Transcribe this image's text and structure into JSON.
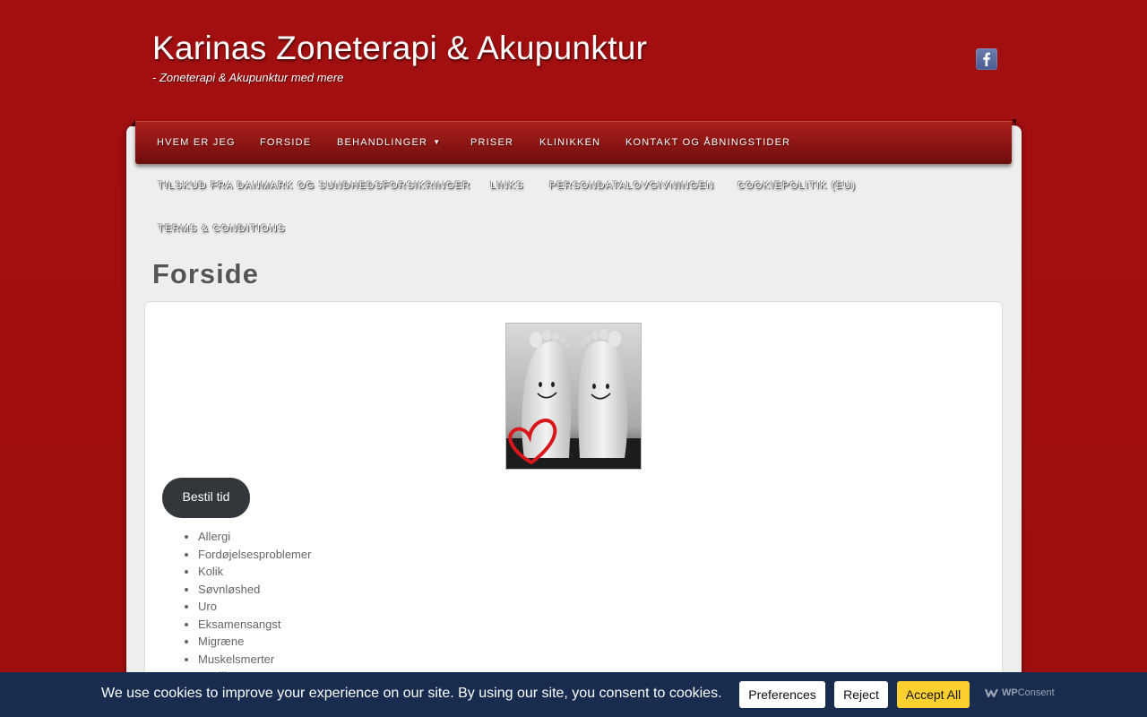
{
  "site": {
    "title": "Karinas Zoneterapi & Akupunktur",
    "tagline": "- Zoneterapi & Akupunktur med mere",
    "social_icon": "facebook-icon"
  },
  "nav": {
    "primary": [
      {
        "label": "HVEM ER JEG"
      },
      {
        "label": "FORSIDE"
      },
      {
        "label": "BEHANDLINGER",
        "has_dropdown": true
      },
      {
        "label": "PRISER"
      },
      {
        "label": "KLINIKKEN"
      },
      {
        "label": "KONTAKT OG ÅBNINGSTIDER"
      }
    ],
    "secondary": [
      {
        "label": "TILSKUD FRA DANMARK OG SUNDHEDSFORSIKRINGER"
      },
      {
        "label": "LINKS"
      },
      {
        "label": "PERSONDATALOVGIVNINGEN"
      },
      {
        "label": "COOKIEPOLITIK (EU)"
      },
      {
        "label": "TERMS & CONDITIONS"
      }
    ]
  },
  "page": {
    "title": "Forside",
    "book_button": "Bestil tid",
    "conditions": [
      "Allergi",
      "Fordøjelsesproblemer",
      "Kolik",
      "Søvnløshed",
      "Uro",
      "Eksamensangst",
      "Migræne",
      "Muskelsmerter",
      "Fertilitet"
    ]
  },
  "cookie_banner": {
    "message": "We use cookies to improve your experience on our site. By using our site, you consent to cookies.",
    "preferences_label": "Preferences",
    "reject_label": "Reject",
    "accept_label": "Accept All",
    "brand_prefix": "WP",
    "brand_suffix": "Consent"
  },
  "colors": {
    "background": "#a01010",
    "nav_bar": "#8a1513",
    "content_bg": "#eeeeee",
    "button_dark": "#32373c",
    "cookie_bar": "#172c4f",
    "accept_button": "#fcd12f"
  }
}
